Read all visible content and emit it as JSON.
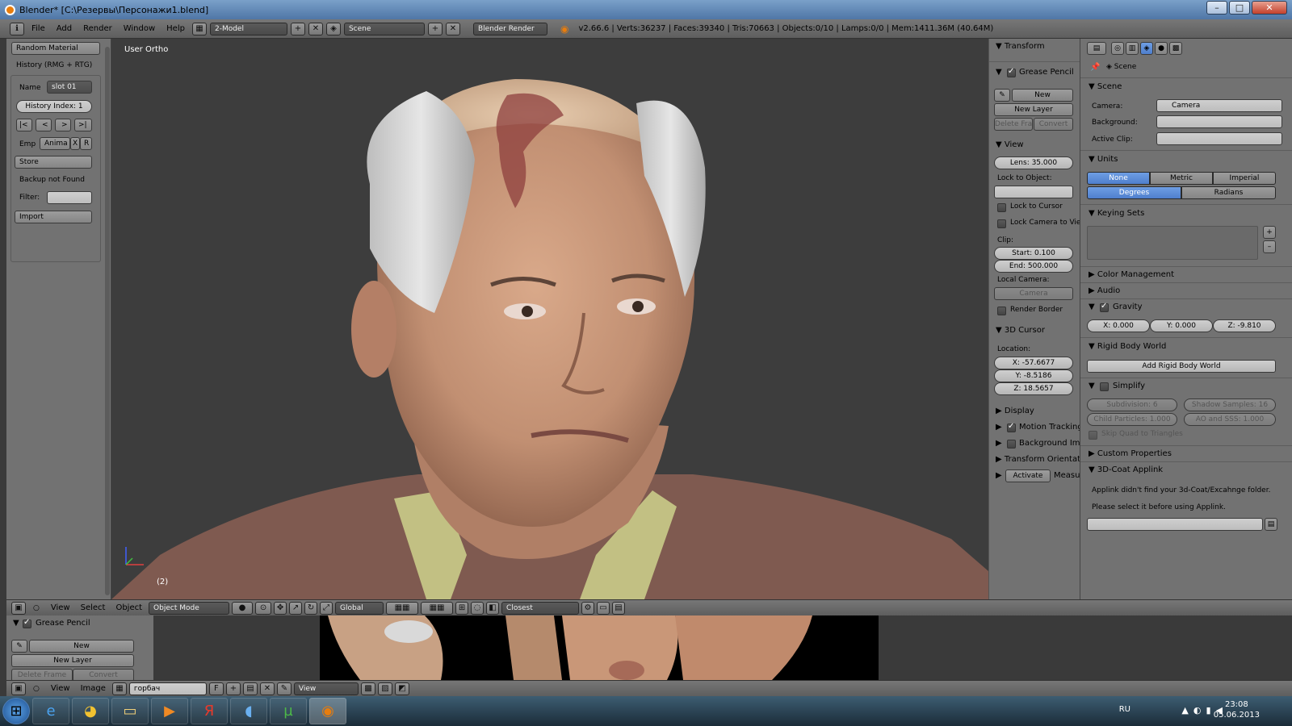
{
  "window": {
    "title": "Blender* [C:\\Резервы\\Персонажи1.blend]",
    "min": "–",
    "max": "□",
    "close": "✕"
  },
  "infobar": {
    "menus": [
      "File",
      "Add",
      "Render",
      "Window",
      "Help"
    ],
    "screen_layout": "2-Model",
    "scene": "Scene",
    "render_engine": "Blender Render",
    "stats": "v2.66.6 | Verts:36237 | Faces:39340 | Tris:70663 | Objects:0/10 | Lamps:0/0 | Mem:1411.36M (40.64M)"
  },
  "toolshelf": {
    "random_material": "Random Material",
    "history_title": "History (RMG + RTG)",
    "name_label": "Name",
    "name_value": "slot 01",
    "history_index": "History Index: 1",
    "nav": [
      "|<",
      "<",
      ">",
      ">|"
    ],
    "emp": "Emp",
    "anima": "Anima",
    "x": "X",
    "r": "R",
    "store": "Store",
    "backup": "Backup not Found",
    "filter_label": "Filter:",
    "import": "Import"
  },
  "viewport": {
    "label": "User Ortho",
    "frame": "(2)"
  },
  "npanel": {
    "transform": "Transform",
    "grease_pencil": "Grease Pencil",
    "new": "New",
    "new_layer": "New Layer",
    "delete_frame": "Delete Fra",
    "convert": "Convert",
    "view": "View",
    "lens": "Lens: 35.000",
    "lock_to_object": "Lock to Object:",
    "lock_to_cursor": "Lock to Cursor",
    "lock_camera": "Lock Camera to Vie",
    "clip": "Clip:",
    "clip_start": "Start: 0.100",
    "clip_end": "End: 500.000",
    "local_camera": "Local Camera:",
    "camera": "Camera",
    "render_border": "Render Border",
    "cursor": "3D Cursor",
    "location": "Location:",
    "cx": "X: -57.6677",
    "cy": "Y: -8.5186",
    "cz": "Z: 18.5657",
    "display": "Display",
    "motion_tracking": "Motion Tracking",
    "background_images": "Background Ima",
    "transform_orientations": "Transform Orientatio",
    "activate": "Activate",
    "measure": "Measur"
  },
  "props": {
    "breadcrumb": "Scene",
    "scene_panel": "Scene",
    "camera_label": "Camera:",
    "camera_value": "Camera",
    "background_label": "Background:",
    "active_clip_label": "Active Clip:",
    "units_panel": "Units",
    "unit_systems": [
      "None",
      "Metric",
      "Imperial"
    ],
    "rotation_units": [
      "Degrees",
      "Radians"
    ],
    "keying_sets": "Keying Sets",
    "color_management": "Color Management",
    "audio": "Audio",
    "gravity": "Gravity",
    "gx": "X: 0.000",
    "gy": "Y: 0.000",
    "gz": "Z: -9.810",
    "rigid_body": "Rigid Body World",
    "add_rigid_body": "Add Rigid Body World",
    "simplify": "Simplify",
    "subdivision": "Subdivision: 6",
    "shadow_samples": "Shadow Samples: 16",
    "child_particles": "Child Particles: 1.000",
    "ao_sss": "AO and SSS: 1.000",
    "skip_quad": "Skip Quad to Triangles",
    "custom_props": "Custom Properties",
    "applink": "3D-Coat Applink",
    "applink_msg1": "Applink didn't find your 3d-Coat/Excahnge folder.",
    "applink_msg2": "Please select it before using Applink."
  },
  "vpheader": {
    "menus": [
      "View",
      "Select",
      "Object"
    ],
    "mode": "Object Mode",
    "orientation": "Global",
    "snap": "Closest"
  },
  "imageeditor": {
    "grease_pencil": "Grease Pencil",
    "new": "New",
    "new_layer": "New Layer",
    "delete_frame": "Delete Frame",
    "convert": "Convert",
    "menus": [
      "View",
      "Image"
    ],
    "image_name": "горбач",
    "f": "F",
    "view": "View"
  },
  "taskbar": {
    "lang": "RU",
    "time": "23:08",
    "date": "05.06.2013"
  }
}
